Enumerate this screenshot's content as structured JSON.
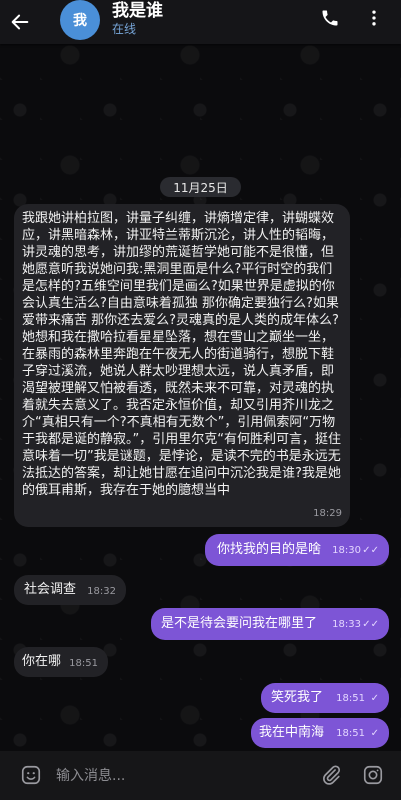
{
  "header": {
    "avatar_text": "我",
    "title": "我是谁",
    "status": "在线"
  },
  "date_pill": "11月25日",
  "messages": [
    {
      "direction": "in",
      "text": "我跟她讲柏拉图，讲量子纠缠，讲熵增定律，讲蝴蝶效应，讲黑暗森林，讲亚特兰蒂斯沉沦，讲人性的韬晦，讲灵魂的思考，讲加缪的荒诞哲学她可能不是很懂，但她愿意听我说她问我:黑洞里面是什么?平行时空的我们是怎样的?五维空间里我们是画么?如果世界是虚拟的你会认真生活么?自由意味着孤独 那你确定要独行么?如果爱带来痛苦 那你还去爱么?灵魂真的是人类的成年体么?她想和我在撒哈拉看星星坠落，想在雪山之巅坐一坐，在暴雨的森林里奔跑在午夜无人的街道骑行，想脱下鞋子穿过溪流，她说人群太吵理想太远，说人真矛盾，即渴望被理解又怕被看透，既然未来不可靠，对灵魂的执着就失去意义了。我否定永恒价值，却又引用芥川龙之介“真相只有一个?不真相有无数个”，引用佩索阿“万物于我都是诞的静寂。”，引用里尔克“有何胜利可言，挺住意味着一切”我是谜题，是悖论，是读不完的书是永远无法抵达的答案，却让她甘愿在追问中沉沦我是谁?我是她的俄耳甫斯，我存在于她的臆想当中",
      "time": "18:29"
    },
    {
      "direction": "out",
      "text": "你找我的目的是啥",
      "time": "18:30",
      "read": "✓✓"
    },
    {
      "direction": "in",
      "text": "社会调查",
      "time": "18:32"
    },
    {
      "direction": "out",
      "text": "是不是待会要问我在哪里了",
      "time": "18:33",
      "read": "✓✓"
    },
    {
      "direction": "in",
      "text": "你在哪",
      "time": "18:51"
    },
    {
      "direction": "out",
      "text": "笑死我了",
      "time": "18:51",
      "read": "✓"
    },
    {
      "direction": "out",
      "text": "我在中南海",
      "time": "18:51",
      "read": "✓"
    }
  ],
  "composer": {
    "placeholder": "输入消息..."
  },
  "colors": {
    "accent": "#7d55d6",
    "incoming_bubble": "#222226",
    "avatar": "#4a8fd8",
    "status": "#76a4d6"
  },
  "icons": [
    "back-arrow-icon",
    "phone-icon",
    "more-vertical-icon",
    "emoji-icon",
    "attach-icon",
    "camera-icon"
  ]
}
